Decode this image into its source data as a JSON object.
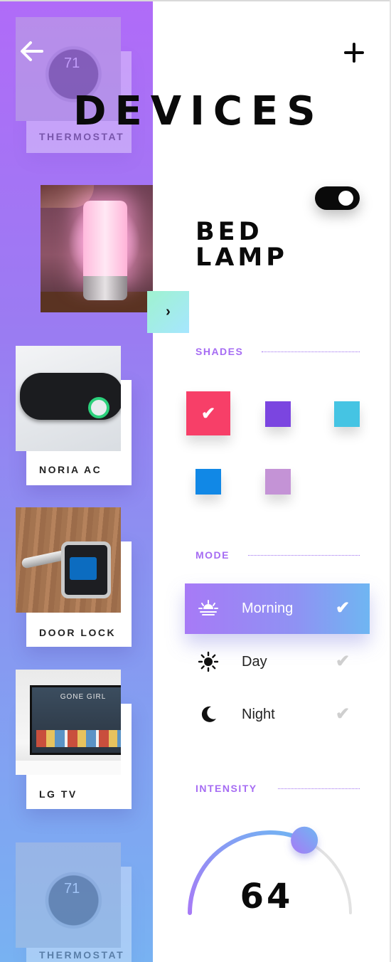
{
  "header": {
    "title": "DEVICES",
    "back_icon": "arrow-left-icon",
    "add_icon": "plus-icon"
  },
  "devices": [
    {
      "label": "THERMOSTAT",
      "icon": "thermostat-photo"
    },
    {
      "label": "BED LAMP",
      "icon": "lamp-photo",
      "selected": true
    },
    {
      "label": "NORIA AC",
      "icon": "air-conditioner-photo"
    },
    {
      "label": "DOOR LOCK",
      "icon": "door-lock-photo"
    },
    {
      "label": "LG TV",
      "icon": "television-photo"
    },
    {
      "label": "THERMOSTAT",
      "icon": "thermostat-photo"
    }
  ],
  "thermostat_reading": "71",
  "tv_screen_title": "GONE GIRL",
  "detail": {
    "name_line1": "BED",
    "name_line2": "LAMP",
    "power_on": true
  },
  "shades": {
    "label": "SHADES",
    "colors": [
      "#f73f68",
      "#7b45e0",
      "#45c4e3",
      "#1188e6",
      "#c493d6"
    ],
    "selected_index": 0
  },
  "mode": {
    "label": "MODE",
    "options": [
      {
        "label": "Morning",
        "icon": "sunrise-icon",
        "active": true
      },
      {
        "label": "Day",
        "icon": "sun-icon",
        "active": false
      },
      {
        "label": "Night",
        "icon": "moon-icon",
        "active": false
      }
    ]
  },
  "intensity": {
    "label": "INTENSITY",
    "value": "64",
    "fraction": 0.64
  },
  "colors": {
    "sidebar_top": "#b06bf8",
    "sidebar_bottom": "#78b2f2",
    "accent": "#a66cf3"
  }
}
